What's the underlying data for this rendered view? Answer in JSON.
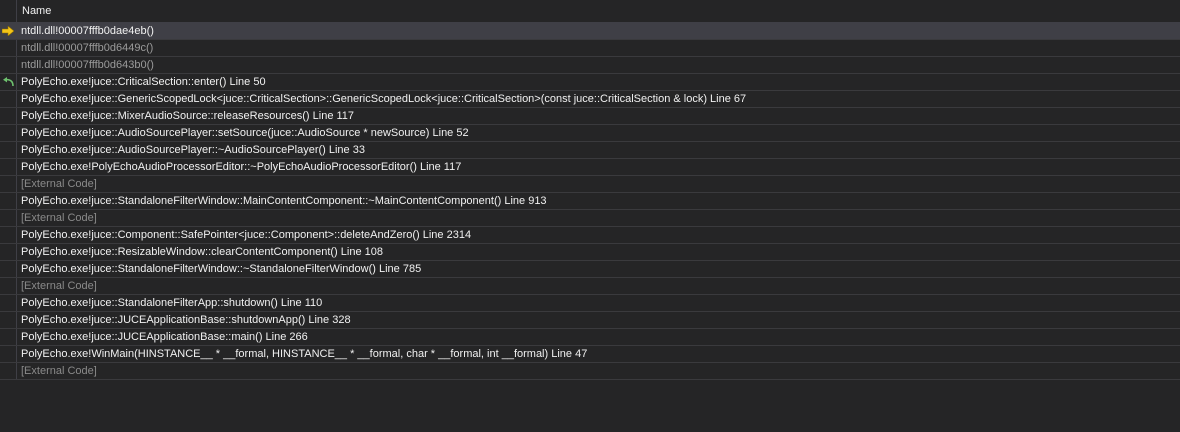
{
  "header": {
    "name_label": "Name"
  },
  "rows": [
    {
      "text": "ntdll.dll!00007fffb0dae4eb()",
      "kind": "current",
      "icon": "current-frame-arrow-icon"
    },
    {
      "text": "ntdll.dll!00007fffb0d6449c()",
      "kind": "dim",
      "icon": ""
    },
    {
      "text": "ntdll.dll!00007fffb0d643b0()",
      "kind": "dim",
      "icon": ""
    },
    {
      "text": "PolyEcho.exe!juce::CriticalSection::enter() Line 50",
      "kind": "normal",
      "icon": "return-point-icon"
    },
    {
      "text": "PolyEcho.exe!juce::GenericScopedLock<juce::CriticalSection>::GenericScopedLock<juce::CriticalSection>(const juce::CriticalSection & lock) Line 67",
      "kind": "normal",
      "icon": ""
    },
    {
      "text": "PolyEcho.exe!juce::MixerAudioSource::releaseResources() Line 117",
      "kind": "normal",
      "icon": ""
    },
    {
      "text": "PolyEcho.exe!juce::AudioSourcePlayer::setSource(juce::AudioSource * newSource) Line 52",
      "kind": "normal",
      "icon": ""
    },
    {
      "text": "PolyEcho.exe!juce::AudioSourcePlayer::~AudioSourcePlayer() Line 33",
      "kind": "normal",
      "icon": ""
    },
    {
      "text": "PolyEcho.exe!PolyEchoAudioProcessorEditor::~PolyEchoAudioProcessorEditor() Line 117",
      "kind": "normal",
      "icon": ""
    },
    {
      "text": "[External Code]",
      "kind": "external",
      "icon": ""
    },
    {
      "text": "PolyEcho.exe!juce::StandaloneFilterWindow::MainContentComponent::~MainContentComponent() Line 913",
      "kind": "normal",
      "icon": ""
    },
    {
      "text": "[External Code]",
      "kind": "external",
      "icon": ""
    },
    {
      "text": "PolyEcho.exe!juce::Component::SafePointer<juce::Component>::deleteAndZero() Line 2314",
      "kind": "normal",
      "icon": ""
    },
    {
      "text": "PolyEcho.exe!juce::ResizableWindow::clearContentComponent() Line 108",
      "kind": "normal",
      "icon": ""
    },
    {
      "text": "PolyEcho.exe!juce::StandaloneFilterWindow::~StandaloneFilterWindow() Line 785",
      "kind": "normal",
      "icon": ""
    },
    {
      "text": "[External Code]",
      "kind": "external",
      "icon": ""
    },
    {
      "text": "PolyEcho.exe!juce::StandaloneFilterApp::shutdown() Line 110",
      "kind": "normal",
      "icon": ""
    },
    {
      "text": "PolyEcho.exe!juce::JUCEApplicationBase::shutdownApp() Line 328",
      "kind": "normal",
      "icon": ""
    },
    {
      "text": "PolyEcho.exe!juce::JUCEApplicationBase::main() Line 266",
      "kind": "normal",
      "icon": ""
    },
    {
      "text": "PolyEcho.exe!WinMain(HINSTANCE__ * __formal, HINSTANCE__ * __formal, char * __formal, int __formal) Line 47",
      "kind": "normal",
      "icon": ""
    },
    {
      "text": "[External Code]",
      "kind": "external",
      "icon": ""
    }
  ],
  "colors": {
    "background": "#252526",
    "selected_row": "#3f3f46",
    "current_arrow": "#f5c518",
    "return_arrow": "#6ec16e",
    "text": "#f1f1f1",
    "dim_text": "#9b9b9b"
  }
}
